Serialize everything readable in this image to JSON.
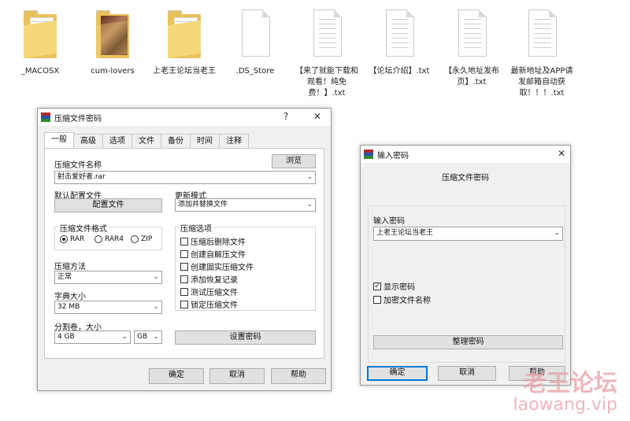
{
  "desktop": {
    "icons": [
      {
        "label": "_MACOSX",
        "kind": "folder"
      },
      {
        "label": "cum-lovers",
        "kind": "folder-photo"
      },
      {
        "label": "上老王论坛当老王",
        "kind": "folder"
      },
      {
        "label": ".DS_Store",
        "kind": "file"
      },
      {
        "label": "【来了就能下载和观看！纯免费！】.txt",
        "kind": "txt"
      },
      {
        "label": "【论坛介绍】.txt",
        "kind": "txt"
      },
      {
        "label": "【永久地址发布页】.txt",
        "kind": "txt"
      },
      {
        "label": "最新地址及APP请发邮箱自动获取！！！.txt",
        "kind": "txt"
      }
    ]
  },
  "archive_dialog": {
    "title": "压缩文件密码",
    "help_symbol": "?",
    "close_symbol": "✕",
    "tabs": [
      "一般",
      "高级",
      "选项",
      "文件",
      "备份",
      "时间",
      "注释"
    ],
    "archive_name_label": "压缩文件名称",
    "archive_name_value": "射击爱好者.rar",
    "browse_label": "浏览",
    "default_profile_label": "默认配置文件",
    "profiles_button": "配置文件",
    "update_mode_label": "更新模式",
    "update_mode_value": "添加并替换文件",
    "format_group": "压缩文件格式",
    "formats": [
      "RAR",
      "RAR4",
      "ZIP"
    ],
    "compression_options_group": "压缩选项",
    "options": [
      {
        "label": "压缩后删除文件",
        "checked": false
      },
      {
        "label": "创建自解压文件",
        "checked": false
      },
      {
        "label": "创建固实压缩文件",
        "checked": false
      },
      {
        "label": "添加恢复记录",
        "checked": false
      },
      {
        "label": "测试压缩文件",
        "checked": false
      },
      {
        "label": "锁定压缩文件",
        "checked": false
      }
    ],
    "method_label": "压缩方法",
    "method_value": "正常",
    "dict_label": "字典大小",
    "dict_value": "32 MB",
    "split_label": "分割卷，大小",
    "split_value": "4 GB",
    "split_unit": "GB",
    "set_password_button": "设置密码",
    "ok": "确定",
    "cancel": "取消",
    "help": "帮助"
  },
  "password_dialog": {
    "title": "输入密码",
    "close_symbol": "✕",
    "heading": "压缩文件密码",
    "enter_label": "输入密码",
    "password_value": "上老王论坛当老王",
    "show_password": {
      "label": "显示密码",
      "checked": true
    },
    "encrypt_names": {
      "label": "加密文件名称",
      "checked": false
    },
    "organize_button": "整理密码",
    "ok": "确定",
    "cancel": "取消",
    "help": "帮助"
  },
  "watermark": {
    "line1": "老王论坛",
    "line2": "laowang.vip",
    "color": "#e8a0a6"
  }
}
